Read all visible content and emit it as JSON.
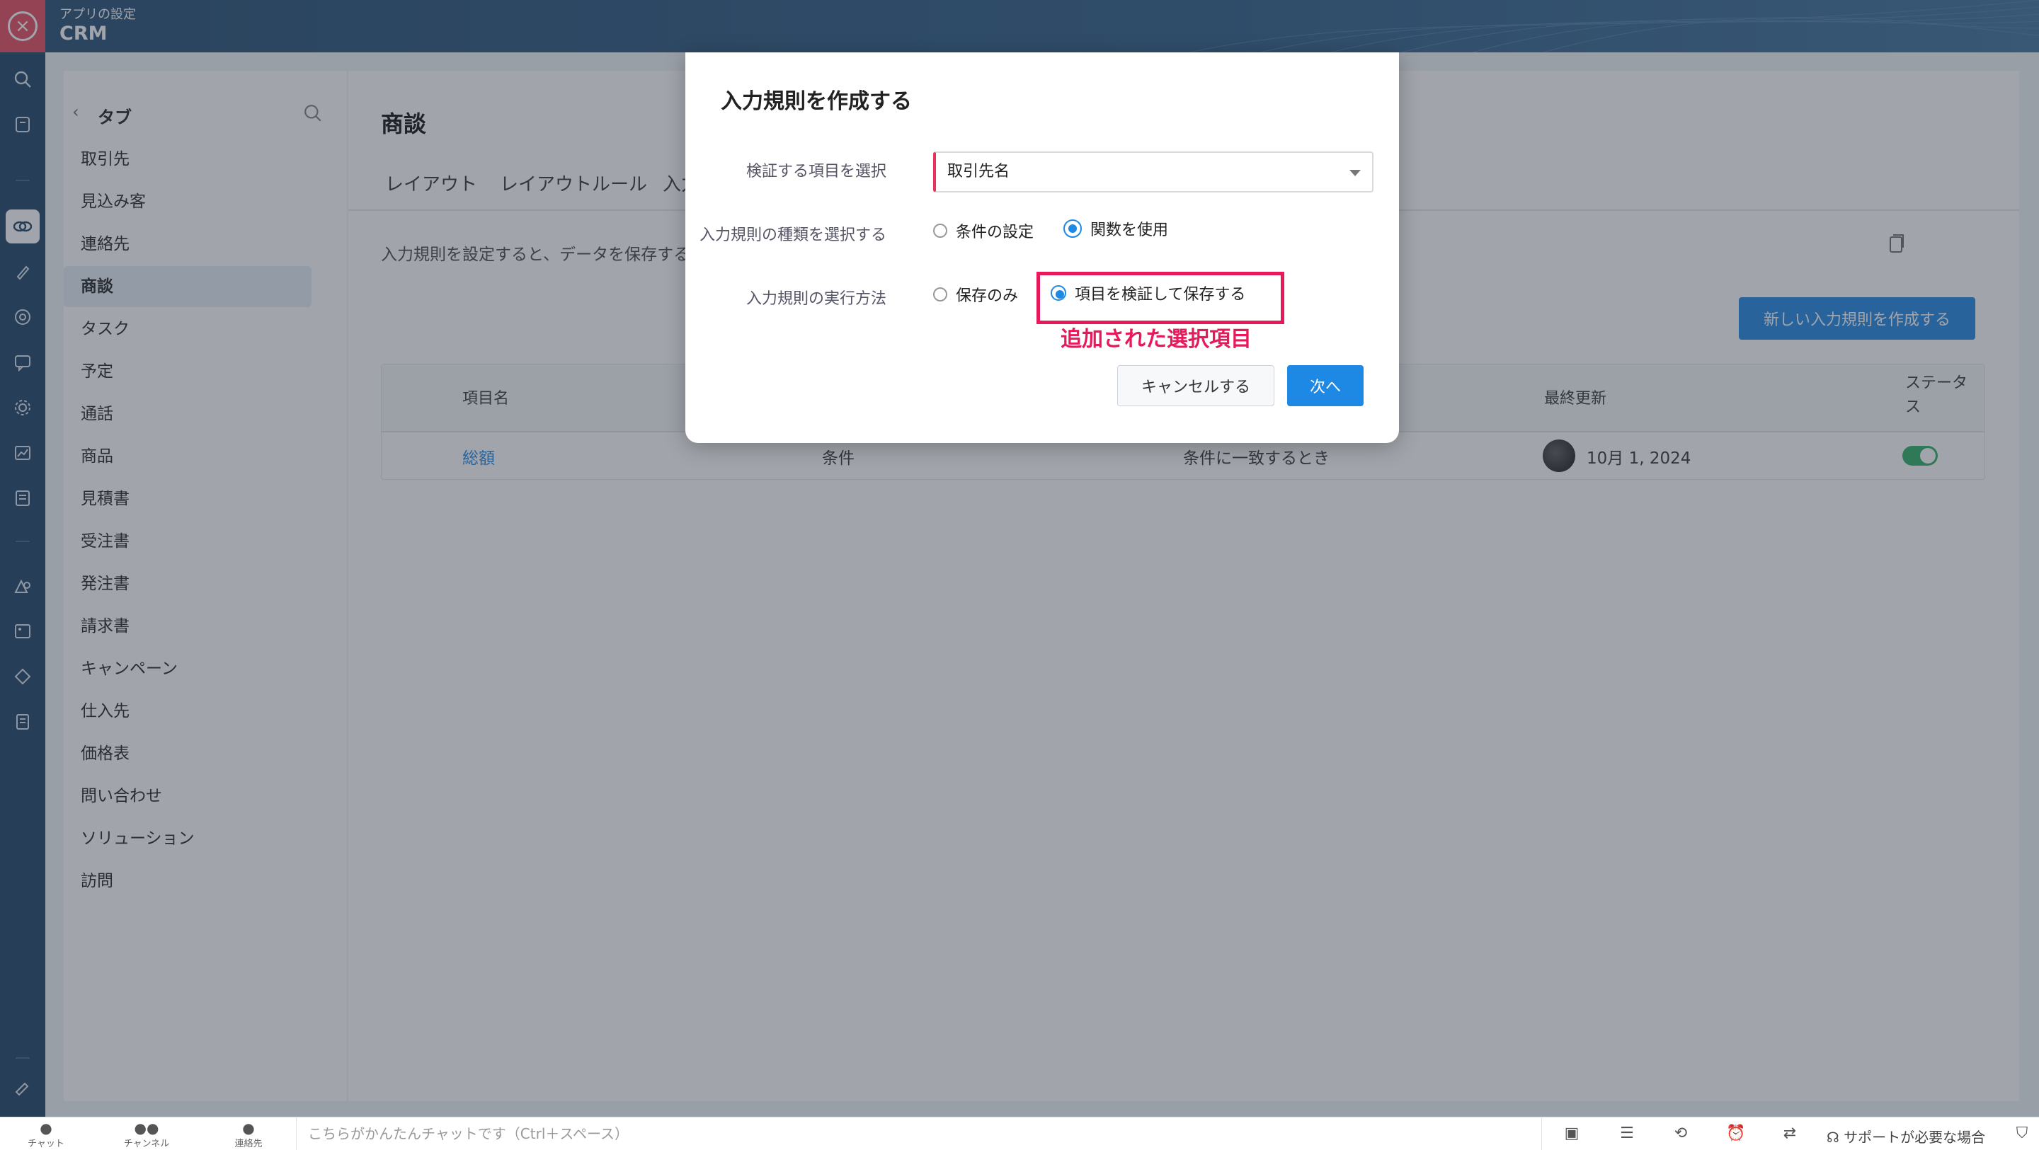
{
  "header": {
    "subtitle": "アプリの設定",
    "title": "CRM"
  },
  "sidebar": {
    "heading": "タブ",
    "items": [
      {
        "label": "取引先"
      },
      {
        "label": "見込み客"
      },
      {
        "label": "連絡先"
      },
      {
        "label": "商談"
      },
      {
        "label": "タスク"
      },
      {
        "label": "予定"
      },
      {
        "label": "通話"
      },
      {
        "label": "商品"
      },
      {
        "label": "見積書"
      },
      {
        "label": "受注書"
      },
      {
        "label": "発注書"
      },
      {
        "label": "請求書"
      },
      {
        "label": "キャンペーン"
      },
      {
        "label": "仕入先"
      },
      {
        "label": "価格表"
      },
      {
        "label": "問い合わせ"
      },
      {
        "label": "ソリューション"
      },
      {
        "label": "訪問"
      }
    ],
    "active_index": 3
  },
  "main": {
    "title": "商談",
    "tabs": [
      "レイアウト",
      "レイアウトルール",
      "入力"
    ],
    "description": "入力規則を設定すると、データを保存する前",
    "new_rule_button": "新しい入力規則を作成する",
    "table": {
      "headers": [
        "項目名",
        "最終更新",
        "ステータス"
      ],
      "rows": [
        {
          "field": "総額",
          "type": "条件",
          "trigger": "条件に一致するとき",
          "updated": "10月 1, 2024",
          "status_on": true
        }
      ]
    }
  },
  "modal": {
    "title": "入力規則を作成する",
    "field_label": "検証する項目を選択",
    "field_value": "取引先名",
    "type_label": "入力規則の種類を選択する",
    "type_options": [
      "条件の設定",
      "関数を使用"
    ],
    "type_selected": "関数を使用",
    "exec_label": "入力規則の実行方法",
    "exec_options": [
      "保存のみ",
      "項目を検証して保存する"
    ],
    "exec_selected": "項目を検証して保存する",
    "annotation": "追加された選択項目",
    "cancel_button": "キャンセルする",
    "next_button": "次へ"
  },
  "bottom_bar": {
    "items": [
      "チャット",
      "チャンネル",
      "連絡先"
    ],
    "chat_placeholder": "こちらがかんたんチャットです（Ctrl＋スペース）",
    "support": "サポートが必要な場合"
  },
  "colors": {
    "accent": "#1e88e5",
    "highlight": "#e6195a",
    "header": "#34597c"
  }
}
